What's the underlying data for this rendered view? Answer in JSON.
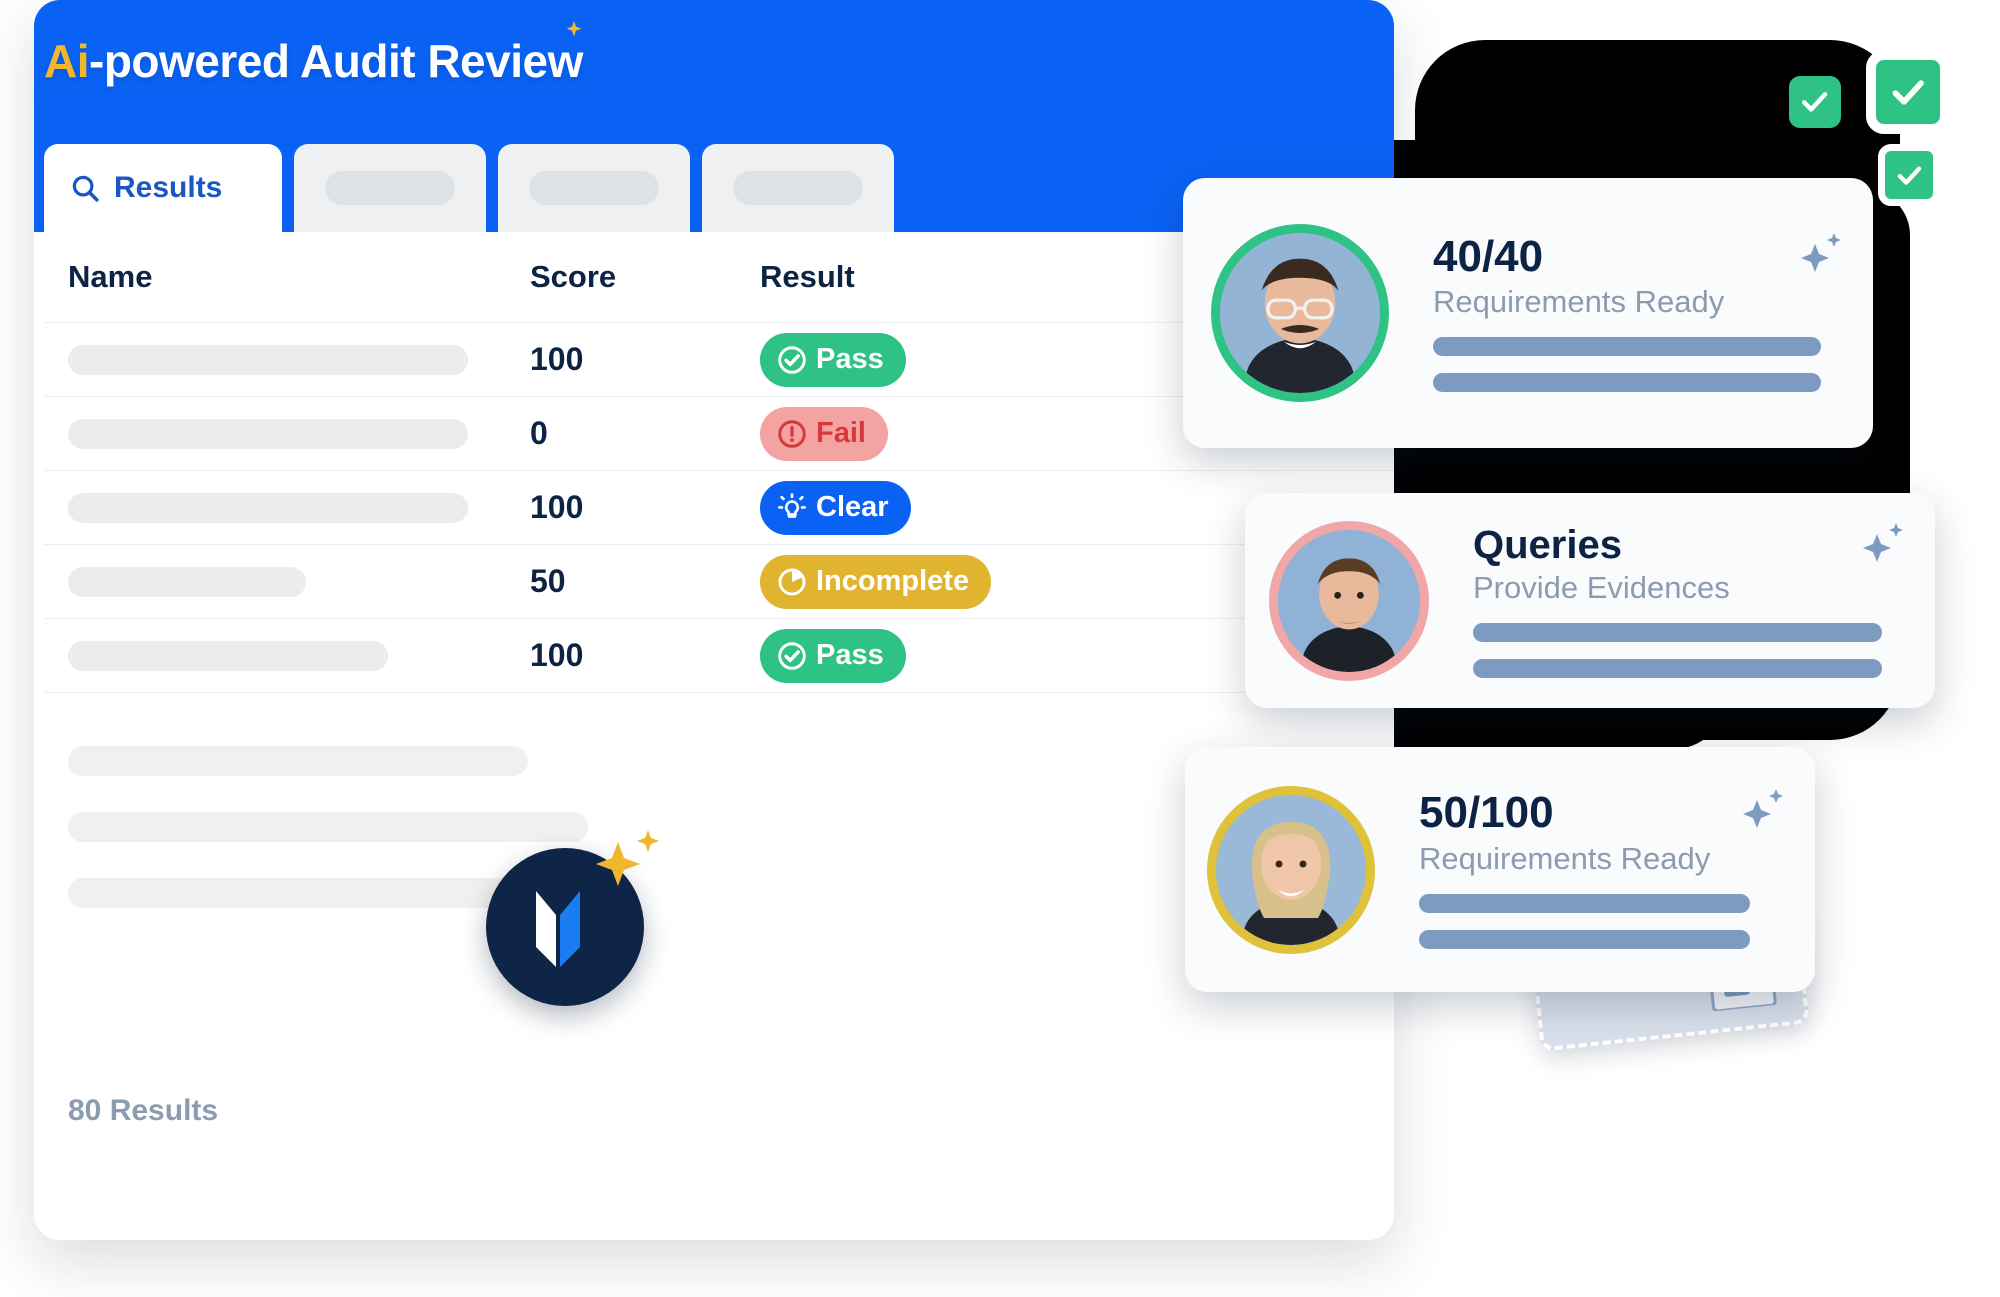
{
  "header": {
    "title_accent": "Ai",
    "title_rest": "-powered Audit Review",
    "accent_color": "#f0b72e",
    "brand_blue": "#0a62f4"
  },
  "tabs": [
    {
      "label": "Results",
      "icon": "search-icon",
      "active": true
    },
    {
      "label": "",
      "icon": "",
      "active": false
    },
    {
      "label": "",
      "icon": "",
      "active": false
    },
    {
      "label": "",
      "icon": "",
      "active": false
    }
  ],
  "table": {
    "columns": [
      "Name",
      "Score",
      "Result"
    ],
    "rows": [
      {
        "name": "",
        "name_width": 400,
        "score": "100",
        "result": "Pass",
        "result_icon": "check-circle-icon",
        "result_style": "pass"
      },
      {
        "name": "",
        "name_width": 400,
        "score": "0",
        "result": "Fail",
        "result_icon": "alert-circle-icon",
        "result_style": "fail"
      },
      {
        "name": "",
        "name_width": 400,
        "score": "100",
        "result": "Clear",
        "result_icon": "lightbulb-icon",
        "result_style": "clear"
      },
      {
        "name": "",
        "name_width": 238,
        "score": "50",
        "result": "Incomplete",
        "result_icon": "pie-timer-icon",
        "result_style": "incomplete"
      },
      {
        "name": "",
        "name_width": 320,
        "score": "100",
        "result": "Pass",
        "result_icon": "check-circle-icon",
        "result_style": "pass"
      }
    ],
    "placeholder_rows": [
      460,
      520,
      460
    ],
    "results_count": "80 Results"
  },
  "status_colors": {
    "pass": "#2ec284",
    "fail_bg": "#f4a3a3",
    "fail_fg": "#d8383c",
    "clear": "#0a62f4",
    "incomplete": "#e0b42f"
  },
  "cards": [
    {
      "headline": "40/40",
      "subtitle": "Requirements Ready",
      "avatar": "avatar-person-1",
      "ring_color": "#2ec284",
      "spark": "sparkle-icon",
      "bars": [
        2,
        2
      ]
    },
    {
      "headline": "Queries",
      "subtitle": "Provide Evidences",
      "avatar": "avatar-person-2",
      "ring_color": "#f1a7a7",
      "spark": "sparkle-icon",
      "bars": [
        2,
        2
      ]
    },
    {
      "headline": "50/100",
      "subtitle": "Requirements Ready",
      "avatar": "avatar-person-3",
      "ring_color": "#e0c23a",
      "spark": "sparkle-icon",
      "bars": [
        2,
        2
      ]
    }
  ],
  "check_chips": [
    {
      "name": "check-chip-small-1",
      "icon": "check-icon"
    },
    {
      "name": "check-chip-large",
      "icon": "check-icon"
    },
    {
      "name": "check-chip-small-2",
      "icon": "check-icon"
    }
  ],
  "logo": {
    "name": "brand-logo",
    "mark": "m-logo-mark",
    "spark": "sparkle-icon"
  },
  "document_card": {
    "name": "document-card",
    "icon": "document-icon"
  }
}
